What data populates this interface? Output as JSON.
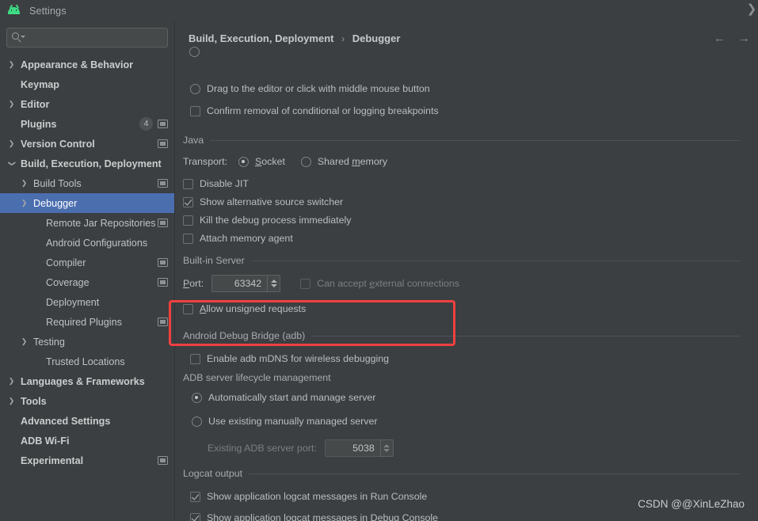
{
  "window": {
    "title": "Settings",
    "logo_icon": "android-studio-logo",
    "close_icon": "close-icon"
  },
  "sidebar": {
    "search": {
      "placeholder": "",
      "value": "",
      "icon": "search-icon"
    },
    "items": [
      {
        "label": "Appearance & Behavior",
        "indent": 0,
        "arrow": "collapsed",
        "bold": true,
        "badge": null,
        "panel_icon": false,
        "selected": false
      },
      {
        "label": "Keymap",
        "indent": 0,
        "arrow": "none",
        "bold": true,
        "badge": null,
        "panel_icon": false,
        "selected": false
      },
      {
        "label": "Editor",
        "indent": 0,
        "arrow": "collapsed",
        "bold": true,
        "badge": null,
        "panel_icon": false,
        "selected": false
      },
      {
        "label": "Plugins",
        "indent": 0,
        "arrow": "none",
        "bold": true,
        "badge": "4",
        "panel_icon": true,
        "selected": false
      },
      {
        "label": "Version Control",
        "indent": 0,
        "arrow": "collapsed",
        "bold": true,
        "badge": null,
        "panel_icon": true,
        "selected": false
      },
      {
        "label": "Build, Execution, Deployment",
        "indent": 0,
        "arrow": "expanded",
        "bold": true,
        "badge": null,
        "panel_icon": false,
        "selected": false
      },
      {
        "label": "Build Tools",
        "indent": 1,
        "arrow": "collapsed",
        "bold": false,
        "badge": null,
        "panel_icon": true,
        "selected": false
      },
      {
        "label": "Debugger",
        "indent": 1,
        "arrow": "collapsed",
        "bold": false,
        "badge": null,
        "panel_icon": false,
        "selected": true
      },
      {
        "label": "Remote Jar Repositories",
        "indent": 2,
        "arrow": "none",
        "bold": false,
        "badge": null,
        "panel_icon": true,
        "selected": false
      },
      {
        "label": "Android Configurations",
        "indent": 2,
        "arrow": "none",
        "bold": false,
        "badge": null,
        "panel_icon": false,
        "selected": false
      },
      {
        "label": "Compiler",
        "indent": 2,
        "arrow": "none",
        "bold": false,
        "badge": null,
        "panel_icon": true,
        "selected": false
      },
      {
        "label": "Coverage",
        "indent": 2,
        "arrow": "none",
        "bold": false,
        "badge": null,
        "panel_icon": true,
        "selected": false
      },
      {
        "label": "Deployment",
        "indent": 2,
        "arrow": "none",
        "bold": false,
        "badge": null,
        "panel_icon": false,
        "selected": false
      },
      {
        "label": "Required Plugins",
        "indent": 2,
        "arrow": "none",
        "bold": false,
        "badge": null,
        "panel_icon": true,
        "selected": false
      },
      {
        "label": "Testing",
        "indent": 1,
        "arrow": "collapsed",
        "bold": false,
        "badge": null,
        "panel_icon": false,
        "selected": false
      },
      {
        "label": "Trusted Locations",
        "indent": 2,
        "arrow": "none",
        "bold": false,
        "badge": null,
        "panel_icon": false,
        "selected": false
      },
      {
        "label": "Languages & Frameworks",
        "indent": 0,
        "arrow": "collapsed",
        "bold": true,
        "badge": null,
        "panel_icon": false,
        "selected": false
      },
      {
        "label": "Tools",
        "indent": 0,
        "arrow": "collapsed",
        "bold": true,
        "badge": null,
        "panel_icon": false,
        "selected": false
      },
      {
        "label": "Advanced Settings",
        "indent": 0,
        "arrow": "none",
        "bold": true,
        "badge": null,
        "panel_icon": false,
        "selected": false
      },
      {
        "label": "ADB Wi-Fi",
        "indent": 0,
        "arrow": "none",
        "bold": true,
        "badge": null,
        "panel_icon": false,
        "selected": false
      },
      {
        "label": "Experimental",
        "indent": 0,
        "arrow": "none",
        "bold": true,
        "badge": null,
        "panel_icon": true,
        "selected": false
      }
    ]
  },
  "main": {
    "breadcrumb": {
      "root": "Build, Execution, Deployment",
      "separator": "›",
      "leaf": "Debugger"
    },
    "nav": {
      "back_icon": "arrow-left-icon",
      "forward_icon": "arrow-right-icon"
    },
    "top_options": [
      {
        "label": "Drag to the editor or click with middle mouse button",
        "type": "radio",
        "checked": false
      },
      {
        "label": "Confirm removal of conditional or logging breakpoints",
        "type": "checkbox",
        "checked": false
      }
    ],
    "java_section": {
      "title": "Java",
      "transport_label": "Transport:",
      "transport_options": [
        {
          "label": "Socket",
          "mnemonic": "S",
          "checked": true
        },
        {
          "label": "Shared memory",
          "mnemonic": "m",
          "checked": false
        }
      ],
      "checkboxes": [
        {
          "label": "Disable JIT",
          "checked": false
        },
        {
          "label": "Show alternative source switcher",
          "checked": true
        },
        {
          "label": "Kill the debug process immediately",
          "checked": false
        },
        {
          "label": "Attach memory agent",
          "checked": false
        }
      ]
    },
    "builtin_server": {
      "title": "Built-in Server",
      "port_label": "Port:",
      "port_mnemonic": "P",
      "port_value": "63342",
      "external_label": "Can accept external connections",
      "external_mnemonic": "e",
      "external_checked": false,
      "external_disabled": true,
      "unsigned_label": "Allow unsigned requests",
      "unsigned_mnemonic": "A",
      "unsigned_checked": false
    },
    "adb_section": {
      "title": "Android Debug Bridge (adb)",
      "mdns_label": "Enable adb mDNS for wireless debugging",
      "mdns_checked": false,
      "highlight_color": "#f04040"
    },
    "adb_lifecycle": {
      "title": "ADB server lifecycle management",
      "options": [
        {
          "label": "Automatically start and manage server",
          "checked": true
        },
        {
          "label": "Use existing manually managed server",
          "checked": false
        }
      ],
      "port_label": "Existing ADB server port:",
      "port_value": "5038",
      "port_disabled": true
    },
    "logcat": {
      "title": "Logcat output",
      "checkboxes": [
        {
          "label": "Show application logcat messages in Run Console",
          "checked": true
        },
        {
          "label": "Show application logcat messages in Debug Console",
          "checked": true
        }
      ]
    },
    "watermark": "CSDN @@XinLeZhao"
  }
}
